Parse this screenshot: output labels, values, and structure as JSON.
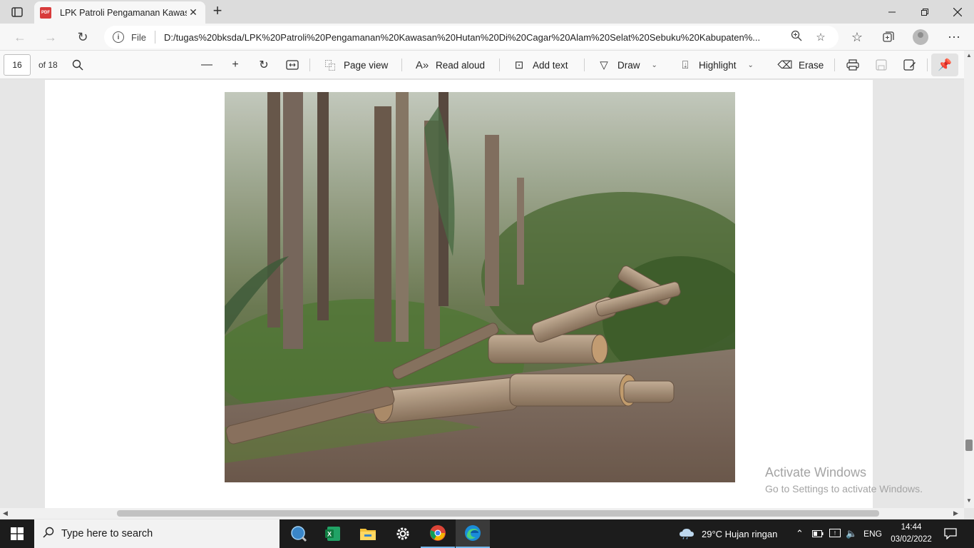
{
  "browser": {
    "tab": {
      "title": "LPK Patroli Pengamanan Kawasan Hutan Di Cagar Alam",
      "icon": "pdf-icon",
      "icon_label": "PDF"
    },
    "new_tab_symbol": "+",
    "address": {
      "scheme": "File",
      "url": "D:/tugas%20bksda/LPK%20Patroli%20Pengamanan%20Kawasan%20Hutan%20Di%20Cagar%20Alam%20Selat%20Sebuku%20Kabupaten%..."
    }
  },
  "pdf_toolbar": {
    "current_page": "16",
    "total_pages": "of 18",
    "page_view": "Page view",
    "read_aloud": "Read aloud",
    "add_text": "Add text",
    "draw": "Draw",
    "highlight": "Highlight",
    "erase": "Erase"
  },
  "document": {
    "image_description_icon": "photo-logs-in-forest"
  },
  "watermark": {
    "line1": "Activate Windows",
    "line2": "Go to Settings to activate Windows."
  },
  "taskbar": {
    "search_placeholder": "Type here to search",
    "weather": "29°C  Hujan ringan",
    "language": "ENG",
    "time": "14:44",
    "date": "03/02/2022"
  },
  "colors": {
    "accent": "#76b9ed",
    "taskbar_bg": "#1c1c1c",
    "pdf_red": "#d83b3b"
  }
}
